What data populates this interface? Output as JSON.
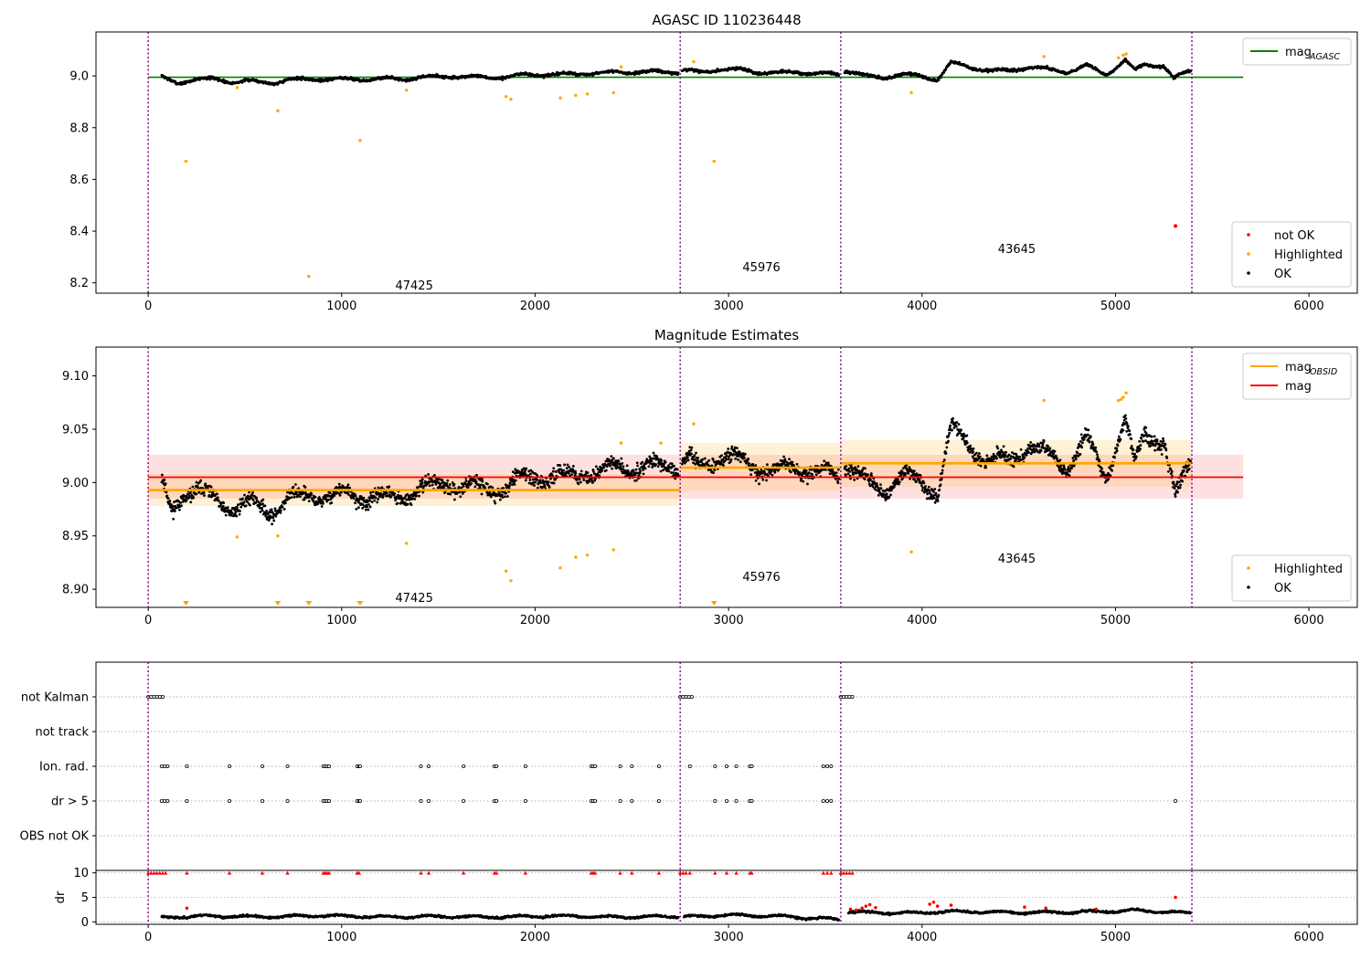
{
  "figure": {
    "background": "#ffffff"
  },
  "colors": {
    "ok": "#000000",
    "highlighted": "#ffa500",
    "not_ok": "#ff0000",
    "mag_agasc": "#008000",
    "mag_obsid": "#ffa500",
    "mag": "#ff0000",
    "obsid_boundary": "#800080",
    "flag_grid": "#b0b0b0"
  },
  "chart_data": [
    {
      "id": "top",
      "type": "scatter",
      "title": "AGASC ID 110236448",
      "xlim": [
        -270,
        6250
      ],
      "ylim": [
        8.16,
        9.17
      ],
      "xticks": [
        0,
        1000,
        2000,
        3000,
        4000,
        5000,
        6000
      ],
      "yticks": [
        8.2,
        8.4,
        8.6,
        8.8,
        9.0
      ],
      "ytick_labels": [
        "8.2",
        "8.4",
        "8.6",
        "8.8",
        "9.0"
      ],
      "obsid_boundaries": [
        0,
        2750,
        3580,
        5395
      ],
      "obsid_labels": [
        {
          "text": "47425",
          "x": 1375,
          "y": 8.175
        },
        {
          "text": "45976",
          "x": 3170,
          "y": 8.245
        },
        {
          "text": "43645",
          "x": 4490,
          "y": 8.315
        }
      ],
      "lines": [
        {
          "name": "mag_AGASC",
          "x": [
            0,
            5660
          ],
          "y": [
            8.995,
            8.995
          ],
          "color": "mag_agasc"
        }
      ],
      "legends": [
        {
          "position": "top-right",
          "entries": [
            {
              "label": "mag",
              "sub": "AGASC",
              "kind": "line",
              "color": "mag_agasc"
            }
          ]
        },
        {
          "position": "bottom-right",
          "entries": [
            {
              "label": "not OK",
              "kind": "dot",
              "color": "not_ok"
            },
            {
              "label": "Highlighted",
              "kind": "dot",
              "color": "highlighted"
            },
            {
              "label": "OK",
              "kind": "dot",
              "color": "ok"
            }
          ]
        }
      ],
      "series": [
        {
          "name": "OK",
          "role": "ok",
          "color": "ok",
          "segments": [
            {
              "x": [
                70,
                150,
                250,
                350,
                450,
                550,
                650,
                750,
                850,
                950,
                1050,
                1150,
                1250,
                1350,
                1450,
                1550,
                1650,
                1750,
                1850,
                1950,
                2050,
                2150,
                2250,
                2350,
                2450,
                2550,
                2650,
                2740
              ],
              "y": [
                8.995,
                8.975,
                8.985,
                8.99,
                8.975,
                8.98,
                8.975,
                8.985,
                8.99,
                8.985,
                8.99,
                8.985,
                8.99,
                8.99,
                8.995,
                9.0,
                8.995,
                8.995,
                8.995,
                9.005,
                9.005,
                9.005,
                9.01,
                9.01,
                9.015,
                9.015,
                9.015,
                9.015
              ]
            },
            {
              "x": [
                2760,
                2850,
                2950,
                3050,
                3150,
                3250,
                3350,
                3450,
                3570
              ],
              "y": [
                9.02,
                9.015,
                9.025,
                9.025,
                9.015,
                9.01,
                9.015,
                9.01,
                9.005
              ]
            },
            {
              "x": [
                3600,
                3700,
                3800,
                3900,
                4000,
                4080,
                4150,
                4250,
                4350,
                4450,
                4550,
                4650,
                4750,
                4850,
                4950,
                5050,
                5100,
                5150,
                5250,
                5300,
                5390
              ],
              "y": [
                9.02,
                9.0,
                8.995,
                9.005,
                9.0,
                8.985,
                9.05,
                9.035,
                9.02,
                9.02,
                9.035,
                9.025,
                9.015,
                9.04,
                9.005,
                9.06,
                9.02,
                9.045,
                9.04,
                8.99,
                9.02
              ]
            }
          ]
        },
        {
          "name": "Highlighted",
          "role": "highlighted",
          "color": "highlighted",
          "x": [
            195,
            460,
            670,
            830,
            1095,
            1335,
            1850,
            1875,
            2130,
            2210,
            2270,
            2405,
            2445,
            2820,
            2925,
            3945,
            4630,
            5015,
            5040,
            5055
          ],
          "y": [
            8.67,
            8.955,
            8.865,
            8.225,
            8.75,
            8.945,
            8.92,
            8.91,
            8.915,
            8.925,
            8.93,
            8.935,
            9.035,
            9.055,
            8.67,
            8.935,
            9.075,
            9.07,
            9.08,
            9.085
          ]
        },
        {
          "name": "not OK",
          "role": "not_ok",
          "color": "not_ok",
          "x": [
            5310
          ],
          "y": [
            8.42
          ]
        }
      ]
    },
    {
      "id": "middle",
      "type": "scatter",
      "title": "Magnitude Estimates",
      "xlim": [
        -270,
        6250
      ],
      "ylim": [
        8.883,
        9.127
      ],
      "xticks": [
        0,
        1000,
        2000,
        3000,
        4000,
        5000,
        6000
      ],
      "yticks": [
        8.9,
        8.95,
        9.0,
        9.05,
        9.1
      ],
      "ytick_labels": [
        "8.90",
        "8.95",
        "9.00",
        "9.05",
        "9.10"
      ],
      "obsid_boundaries": [
        0,
        2750,
        3580,
        5395
      ],
      "obsid_labels": [
        {
          "text": "47425",
          "x": 1375,
          "y": 8.888
        },
        {
          "text": "45976",
          "x": 3170,
          "y": 8.908
        },
        {
          "text": "43645",
          "x": 4490,
          "y": 8.925
        }
      ],
      "mag": {
        "value": 9.005,
        "band": [
          8.985,
          9.026
        ],
        "x": [
          0,
          5660
        ]
      },
      "mag_obsid": [
        {
          "x": [
            0,
            2750
          ],
          "value": 8.993,
          "band": [
            8.978,
            9.008
          ]
        },
        {
          "x": [
            2750,
            3580
          ],
          "value": 9.014,
          "band": [
            8.992,
            9.037
          ]
        },
        {
          "x": [
            3580,
            5395
          ],
          "value": 9.018,
          "band": [
            8.996,
            9.04
          ]
        }
      ],
      "legends": [
        {
          "position": "top-right",
          "entries": [
            {
              "label": "mag",
              "sub": "OBSID",
              "kind": "line",
              "color": "mag_obsid"
            },
            {
              "label": "mag",
              "kind": "line",
              "color": "mag"
            }
          ]
        },
        {
          "position": "bottom-right",
          "entries": [
            {
              "label": "Highlighted",
              "kind": "dot",
              "color": "highlighted"
            },
            {
              "label": "OK",
              "kind": "dot",
              "color": "ok"
            }
          ]
        }
      ],
      "series": [
        {
          "name": "OK",
          "role": "ok",
          "color": "ok",
          "segments": [
            {
              "x": [
                70,
                120,
                170,
                250,
                350,
                450,
                550,
                650,
                750,
                850,
                950,
                1050,
                1150,
                1250,
                1350,
                1450,
                1550,
                1650,
                1750,
                1850,
                1950,
                2050,
                2150,
                2250,
                2350,
                2450,
                2550,
                2650,
                2740
              ],
              "y": [
                9.0,
                8.975,
                8.99,
                8.99,
                8.985,
                8.975,
                8.98,
                8.975,
                8.985,
                8.99,
                8.985,
                8.99,
                8.985,
                8.985,
                8.99,
                8.995,
                9.0,
                8.995,
                8.995,
                8.995,
                9.005,
                9.005,
                9.005,
                9.01,
                9.01,
                9.015,
                9.015,
                9.015,
                9.015
              ]
            },
            {
              "x": [
                2760,
                2850,
                2950,
                3050,
                3150,
                3250,
                3350,
                3450,
                3570
              ],
              "y": [
                9.02,
                9.015,
                9.025,
                9.02,
                9.015,
                9.01,
                9.015,
                9.01,
                9.005
              ]
            },
            {
              "x": [
                3600,
                3700,
                3800,
                3900,
                4000,
                4080,
                4150,
                4250,
                4350,
                4450,
                4550,
                4650,
                4750,
                4850,
                4950,
                5050,
                5100,
                5150,
                5250,
                5310,
                5390
              ],
              "y": [
                9.02,
                9.0,
                8.995,
                9.005,
                9.0,
                8.99,
                9.05,
                9.035,
                9.02,
                9.02,
                9.035,
                9.025,
                9.015,
                9.04,
                9.005,
                9.06,
                9.015,
                9.045,
                9.04,
                8.985,
                9.02
              ]
            }
          ]
        },
        {
          "name": "Highlighted",
          "role": "highlighted",
          "color": "highlighted",
          "x": [
            460,
            670,
            1335,
            1850,
            1875,
            2130,
            2210,
            2270,
            2405,
            2445,
            2650,
            2820,
            3945,
            4630,
            5015,
            5030,
            5040,
            5055
          ],
          "y": [
            8.949,
            8.95,
            8.943,
            8.917,
            8.908,
            8.92,
            8.93,
            8.932,
            8.937,
            9.037,
            9.037,
            9.055,
            8.935,
            9.077,
            9.077,
            9.078,
            9.08,
            9.084
          ]
        },
        {
          "name": "Highlighted (below axis)",
          "role": "highlighted_offscale",
          "color": "highlighted",
          "x": [
            195,
            670,
            830,
            1095,
            2925
          ],
          "y": [
            8.885,
            8.885,
            8.885,
            8.885,
            8.885
          ]
        }
      ]
    },
    {
      "id": "flags",
      "type": "scatter",
      "title": "",
      "xlim": [
        -270,
        6250
      ],
      "ylim": [
        0,
        6
      ],
      "obsid_boundaries": [
        0,
        2750,
        3580,
        5395
      ],
      "ytick_labels": [
        "not Kalman",
        "not track",
        "Ion. rad.",
        "dr > 5",
        "OBS not OK"
      ],
      "rows": [
        {
          "label": "not Kalman",
          "level": 5,
          "x": [
            0,
            15,
            30,
            45,
            60,
            75,
            2750,
            2765,
            2780,
            2795,
            2810,
            3580,
            3595,
            3610,
            3625,
            3640
          ]
        },
        {
          "label": "not track",
          "level": 4,
          "x": []
        },
        {
          "label": "Ion. rad.",
          "level": 3,
          "x": [
            70,
            85,
            100,
            200,
            420,
            590,
            720,
            905,
            915,
            925,
            935,
            1080,
            1090,
            1095,
            1410,
            1450,
            1630,
            1790,
            1800,
            1950,
            2290,
            2300,
            2310,
            2440,
            2500,
            2640,
            2800,
            2930,
            2990,
            3040,
            3110,
            3120,
            3490,
            3510,
            3530
          ]
        },
        {
          "label": "dr > 5",
          "level": 2,
          "x": [
            70,
            85,
            100,
            200,
            420,
            590,
            720,
            905,
            915,
            925,
            935,
            1080,
            1090,
            1095,
            1410,
            1450,
            1630,
            1790,
            1800,
            1950,
            2290,
            2300,
            2310,
            2440,
            2500,
            2640,
            2930,
            2990,
            3040,
            3110,
            3120,
            3490,
            3510,
            3530,
            5310
          ]
        },
        {
          "label": "OBS not OK",
          "level": 1,
          "x": []
        }
      ]
    },
    {
      "id": "dr",
      "type": "scatter",
      "title": "",
      "ylabel": "dr",
      "xlim": [
        -270,
        6250
      ],
      "ylim": [
        -0.5,
        10.5
      ],
      "xticks": [
        0,
        1000,
        2000,
        3000,
        4000,
        5000,
        6000
      ],
      "yticks": [
        0,
        5,
        10
      ],
      "ytick_labels": [
        "0",
        "5",
        "10"
      ],
      "obsid_boundaries": [
        0,
        2750,
        3580,
        5395
      ],
      "series": [
        {
          "name": "OK",
          "role": "ok",
          "color": "ok",
          "segments": [
            {
              "x": [
                70,
                300,
                600,
                900,
                1200,
                1500,
                1800,
                2100,
                2400,
                2740
              ],
              "y": [
                0.9,
                1.2,
                1.0,
                1.3,
                1.0,
                1.1,
                1.0,
                1.2,
                1.0,
                1.1
              ]
            },
            {
              "x": [
                2770,
                3000,
                3300,
                3570
              ],
              "y": [
                1.0,
                1.4,
                1.1,
                0.5
              ]
            },
            {
              "x": [
                3620,
                3900,
                4200,
                4500,
                4800,
                5100,
                5390
              ],
              "y": [
                2.0,
                1.8,
                2.1,
                1.9,
                2.0,
                2.3,
                1.8
              ]
            }
          ]
        },
        {
          "name": "not OK",
          "role": "not_ok",
          "color": "not_ok",
          "x": [
            200,
            3630,
            3660,
            3690,
            3710,
            3730,
            3760,
            4040,
            4060,
            4080,
            4150,
            4530,
            4640,
            4900,
            5310
          ],
          "y": [
            2.8,
            2.6,
            2.4,
            2.8,
            3.2,
            3.5,
            2.9,
            3.6,
            4.0,
            3.2,
            3.4,
            3.0,
            2.8,
            2.6,
            5.0
          ]
        },
        {
          "name": "not OK (clipped)",
          "role": "not_ok_clipped",
          "color": "not_ok",
          "x": [
            0,
            15,
            30,
            45,
            60,
            75,
            90,
            200,
            420,
            590,
            720,
            905,
            915,
            925,
            935,
            1080,
            1090,
            1410,
            1450,
            1630,
            1790,
            1800,
            1950,
            2290,
            2300,
            2310,
            2440,
            2500,
            2640,
            2750,
            2765,
            2780,
            2800,
            2930,
            2990,
            3040,
            3110,
            3120,
            3490,
            3510,
            3530,
            3580,
            3595,
            3610,
            3625,
            3640
          ],
          "y": 10
        }
      ]
    }
  ]
}
